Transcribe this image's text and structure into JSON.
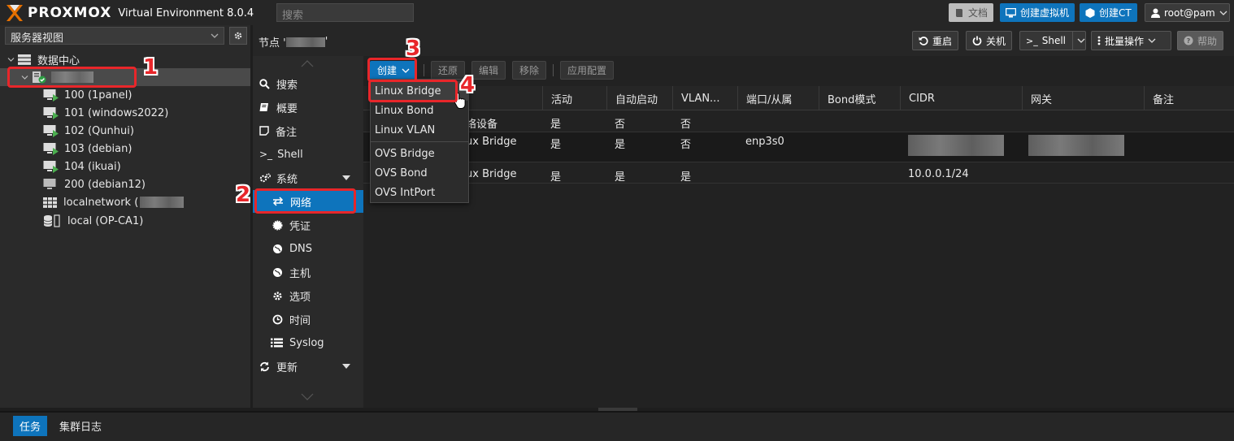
{
  "topbar": {
    "brand": "PROXMOX",
    "version": "Virtual Environment 8.0.4",
    "search_placeholder": "搜索",
    "docs_label": "文档",
    "create_vm_label": "创建虚拟机",
    "create_ct_label": "创建CT",
    "user_label": "root@pam"
  },
  "left": {
    "view_selector": "服务器视图",
    "tree": [
      {
        "label": "数据中心",
        "icon": "datacenter-icon"
      },
      {
        "label": "",
        "icon": "node-online-icon"
      },
      {
        "label": "100 (1panel)",
        "icon": "vm-running-icon"
      },
      {
        "label": "101 (windows2022)",
        "icon": "vm-running-icon"
      },
      {
        "label": "102 (Qunhui)",
        "icon": "vm-running-icon"
      },
      {
        "label": "103 (debian)",
        "icon": "vm-running-icon"
      },
      {
        "label": "104 (ikuai)",
        "icon": "vm-running-icon"
      },
      {
        "label": "200 (debian12)",
        "icon": "vm-stopped-icon"
      },
      {
        "label": "localnetwork (",
        "icon": "network-grid-icon"
      },
      {
        "label": "local (OP-CA1)",
        "icon": "storage-icon"
      }
    ]
  },
  "header": {
    "node_title": "节点 '",
    "node_title_end": "'",
    "reboot_label": "重启",
    "shutdown_label": "关机",
    "shell_label": "Shell",
    "bulk_label": "批量操作",
    "help_label": "帮助"
  },
  "nav": {
    "items": [
      {
        "label": "搜索",
        "icon": "search-icon"
      },
      {
        "label": "概要",
        "icon": "book-icon"
      },
      {
        "label": "备注",
        "icon": "note-icon"
      },
      {
        "label": "Shell",
        "icon": "terminal-icon"
      },
      {
        "label": "系统",
        "icon": "cogs-icon"
      },
      {
        "label": "网络",
        "icon": "exchange-icon"
      },
      {
        "label": "凭证",
        "icon": "certificate-icon"
      },
      {
        "label": "DNS",
        "icon": "globe-icon"
      },
      {
        "label": "主机",
        "icon": "globe-icon"
      },
      {
        "label": "选项",
        "icon": "gear-icon"
      },
      {
        "label": "时间",
        "icon": "clock-icon"
      },
      {
        "label": "Syslog",
        "icon": "list-icon"
      },
      {
        "label": "更新",
        "icon": "refresh-icon"
      }
    ]
  },
  "toolbar": {
    "create_label": "创建",
    "revert_label": "还原",
    "edit_label": "编辑",
    "remove_label": "移除",
    "apply_label": "应用配置"
  },
  "grid": {
    "columns": [
      "活动",
      "自动启动",
      "VLAN...",
      "端口/从属",
      "Bond模式",
      "CIDR",
      "网关",
      "备注"
    ],
    "rows": [
      {
        "type": "络设备",
        "active": "是",
        "autostart": "否",
        "vlan": "否",
        "ports": "",
        "cidr": "",
        "gateway": ""
      },
      {
        "type": "ux Bridge",
        "active": "是",
        "autostart": "是",
        "vlan": "否",
        "ports": "enp3s0",
        "cidr": "",
        "gateway": ""
      },
      {
        "type": "ux Bridge",
        "active": "是",
        "autostart": "是",
        "vlan": "是",
        "ports": "",
        "cidr": "10.0.0.1/24",
        "gateway": ""
      }
    ]
  },
  "create_menu": {
    "items": [
      "Linux Bridge",
      "Linux Bond",
      "Linux VLAN",
      "OVS Bridge",
      "OVS Bond",
      "OVS IntPort"
    ]
  },
  "bottom": {
    "tasks_label": "任务",
    "cluster_log_label": "集群日志"
  },
  "annotations": [
    "1",
    "2",
    "3",
    "4"
  ],
  "colors": {
    "accent": "#0e74bc",
    "highlight": "#e8262a",
    "running": "#4caf50"
  }
}
